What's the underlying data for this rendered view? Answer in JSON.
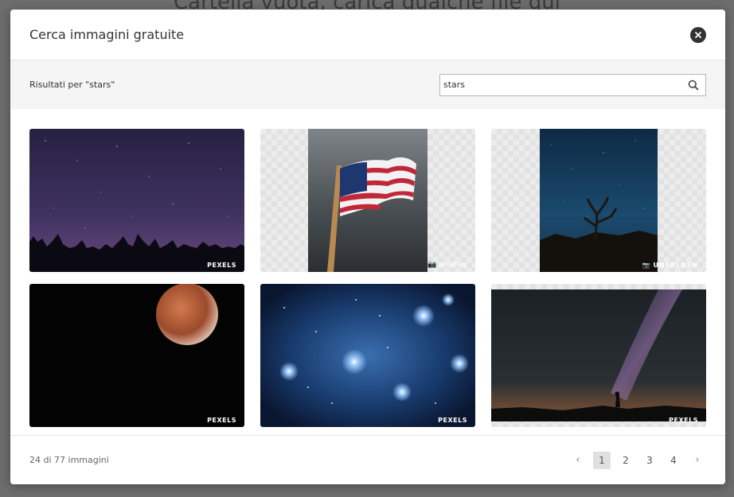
{
  "background": {
    "text": "Cartella vuota, carica qualche file qui"
  },
  "modal": {
    "title": "Cerca immagini gratuite",
    "close_icon": "close-circle-icon"
  },
  "search": {
    "results_label": "Risultati per \"stars\"",
    "value": "stars",
    "icon": "search-icon"
  },
  "images": [
    {
      "subject": "starry night sky over forest",
      "source": "PEXELS"
    },
    {
      "subject": "american flag on pole",
      "source": "pixabay"
    },
    {
      "subject": "joshua tree under stars",
      "source": "UNSPLASH"
    },
    {
      "subject": "red moon in night sky",
      "source": "PEXELS"
    },
    {
      "subject": "pleiades star cluster",
      "source": "PEXELS"
    },
    {
      "subject": "milky way with silhouette",
      "source": "PEXELS"
    }
  ],
  "footer": {
    "count_label": "24 di 77 immagini",
    "prev": "‹",
    "next": "›",
    "pages": [
      "1",
      "2",
      "3",
      "4"
    ],
    "active_page": "1"
  }
}
